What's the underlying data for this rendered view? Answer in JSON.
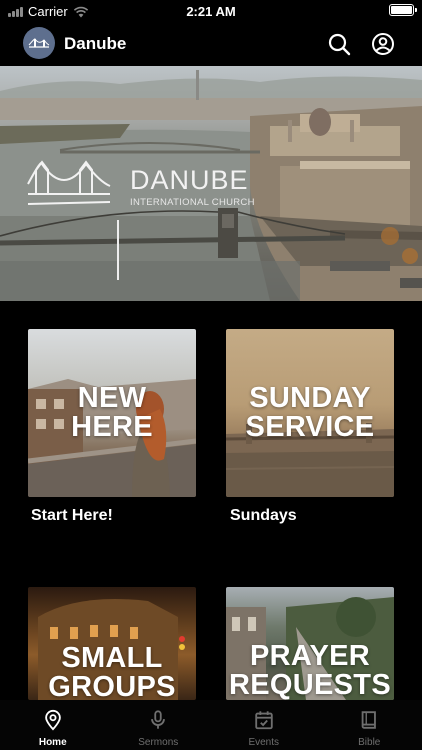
{
  "status_bar": {
    "carrier": "Carrier",
    "time": "2:21 AM",
    "battery_level": 1.0
  },
  "nav": {
    "title": "Danube",
    "search_icon": "search-icon",
    "profile_icon": "user-circle-icon"
  },
  "hero": {
    "brand_name": "DANUBE",
    "brand_sub": "INTERNATIONAL CHURCH"
  },
  "tiles": [
    {
      "title_line1": "NEW",
      "title_line2": "HERE",
      "label": "Start Here!"
    },
    {
      "title_line1": "SUNDAY",
      "title_line2": "SERVICE",
      "label": "Sundays"
    },
    {
      "title_line1": "SMALL",
      "title_line2": "GROUPS",
      "label": ""
    },
    {
      "title_line1": "PRAYER",
      "title_line2": "REQUESTS",
      "label": ""
    }
  ],
  "tab_bar": {
    "items": [
      {
        "label": "Home",
        "icon": "location-pin-icon",
        "active": true
      },
      {
        "label": "Sermons",
        "icon": "microphone-icon",
        "active": false
      },
      {
        "label": "Events",
        "icon": "calendar-icon",
        "active": false
      },
      {
        "label": "Bible",
        "icon": "book-icon",
        "active": false
      }
    ]
  }
}
